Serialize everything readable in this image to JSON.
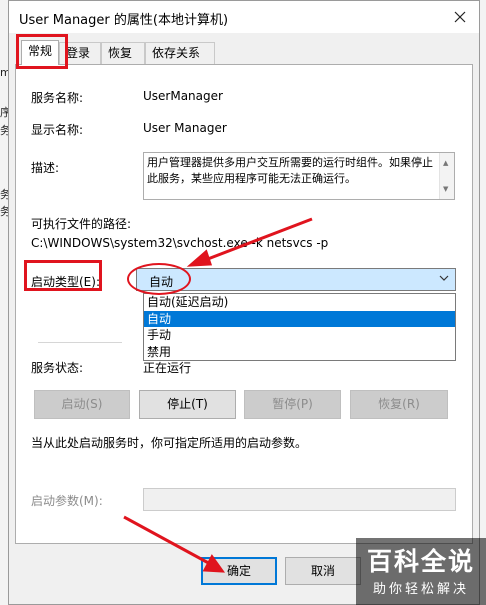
{
  "window": {
    "title": "User Manager 的属性(本地计算机)"
  },
  "tabs": [
    {
      "label": "常规"
    },
    {
      "label": "登录"
    },
    {
      "label": "恢复"
    },
    {
      "label": "依存关系"
    }
  ],
  "general": {
    "service_name_label": "服务名称:",
    "service_name": "UserManager",
    "display_name_label": "显示名称:",
    "display_name": "User Manager",
    "description_label": "描述:",
    "description": "用户管理器提供多用户交互所需要的运行时组件。如果停止此服务，某些应用程序可能无法正确运行。",
    "exe_path_label": "可执行文件的路径:",
    "exe_path": "C:\\WINDOWS\\system32\\svchost.exe -k netsvcs -p",
    "startup_type_label": "启动类型(E):",
    "startup_type_value": "自动",
    "startup_options": [
      "自动(延迟启动)",
      "自动",
      "手动",
      "禁用"
    ],
    "selected_option_index": 1,
    "service_status_label": "服务状态:",
    "service_status": "正在运行",
    "buttons": {
      "start": "启动(S)",
      "stop": "停止(T)",
      "pause": "暂停(P)",
      "resume": "恢复(R)"
    },
    "hint": "当从此处启动服务时，你可指定所适用的启动参数。",
    "start_params_label": "启动参数(M):",
    "start_params_value": ""
  },
  "footer": {
    "ok": "确定",
    "cancel": "取消"
  },
  "watermark": {
    "title": "百科全说",
    "subtitle": "助你轻松解决"
  },
  "background_glyphs": [
    "m",
    "序",
    "务",
    "务",
    "务"
  ],
  "colors": {
    "annotation_red": "#e0141e",
    "selection_blue": "#0078d7",
    "select_highlight": "#cce8ff"
  }
}
